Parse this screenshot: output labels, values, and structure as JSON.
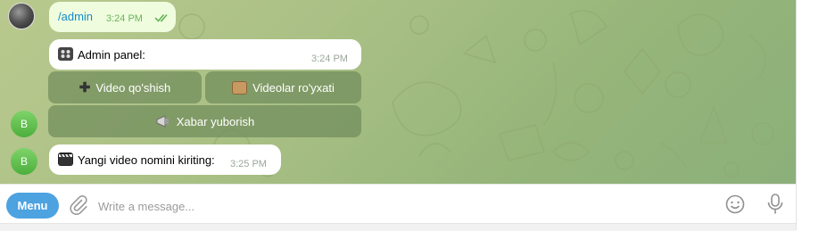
{
  "messages": [
    {
      "type": "outgoing",
      "text": "/admin",
      "time": "3:24 PM"
    },
    {
      "type": "incoming",
      "icon": "control-knobs-icon",
      "text": "Admin panel:",
      "time": "3:24 PM"
    },
    {
      "type": "incoming",
      "icon": "clapper-board-icon",
      "text": "Yangi video nomini kiriting:",
      "time": "3:25 PM"
    }
  ],
  "bot_avatar_letter": "B",
  "keyboard": {
    "buttons": [
      {
        "icon": "plus-icon",
        "label": "Video qo'shish"
      },
      {
        "icon": "scroll-icon",
        "label": "Videolar ro'yxati"
      },
      {
        "icon": "megaphone-icon",
        "label": "Xabar yuborish"
      }
    ]
  },
  "input_bar": {
    "menu_label": "Menu",
    "placeholder": "Write a message..."
  },
  "colors": {
    "outgoing_bubble": "#effdde",
    "incoming_bubble": "#ffffff",
    "link_blue": "#168acd",
    "menu_button": "#4da2e0",
    "keyboard_button": "#708c5c"
  }
}
